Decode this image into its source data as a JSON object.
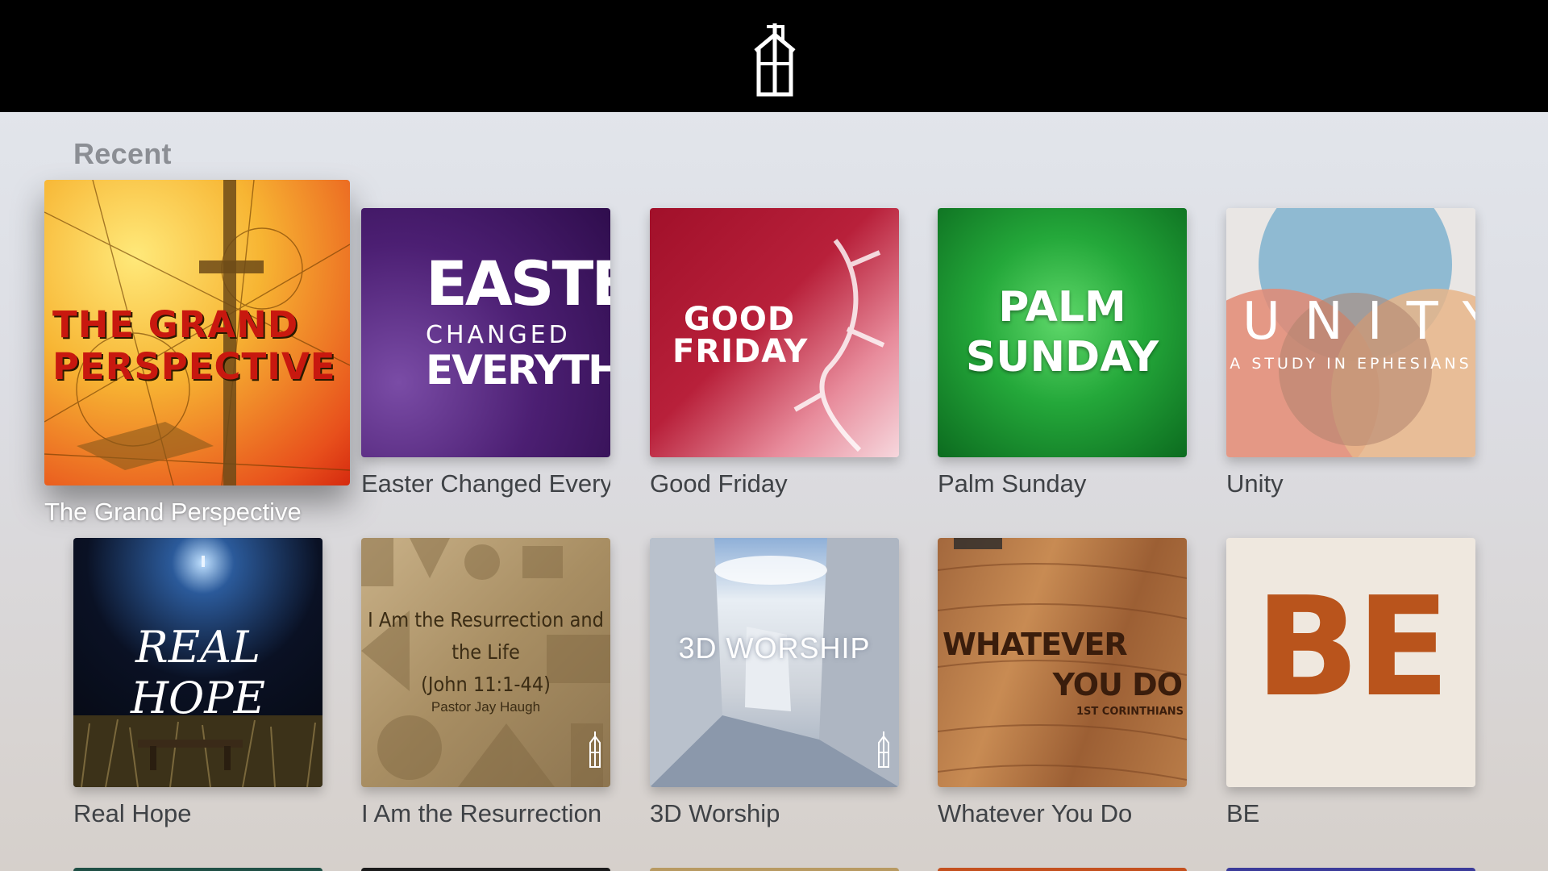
{
  "header": {
    "logo_icon": "church-tower-logo-icon"
  },
  "section": {
    "title": "Recent"
  },
  "tiles": [
    {
      "caption": "The Grand Perspective",
      "art_title": "THE GRAND PERSPECTIVE"
    },
    {
      "caption": "Easter Changed Every",
      "art_line1": "EASTER",
      "art_line2": "CHANGED",
      "art_line3": "EVERYTHING"
    },
    {
      "caption": "Good Friday",
      "art_line1": "GOOD",
      "art_line2": "FRIDAY"
    },
    {
      "caption": "Palm Sunday",
      "art_line1": "PALM",
      "art_line2": "SUNDAY"
    },
    {
      "caption": "Unity",
      "art_title": "UNITY",
      "art_subtitle": "A STUDY IN EPHESIANS"
    },
    {
      "caption": "Real Hope",
      "art_title": "REAL HOPE"
    },
    {
      "caption": "I Am the Resurrection",
      "art_line1": "I Am the Resurrection and the Life",
      "art_line2": "(John 11:1-44)",
      "art_pastor": "Pastor Jay Haugh"
    },
    {
      "caption": "3D Worship",
      "art_title": "3D WORSHIP"
    },
    {
      "caption": "Whatever You Do",
      "art_line1": "WHATEVER",
      "art_line2": "YOU DO",
      "art_line3": "1ST CORINTHIANS"
    },
    {
      "caption": "BE",
      "art_title": "BE"
    }
  ],
  "colors": {
    "header_bg": "#000000",
    "section_title": "#8b8e94",
    "caption": "#3f4246"
  }
}
